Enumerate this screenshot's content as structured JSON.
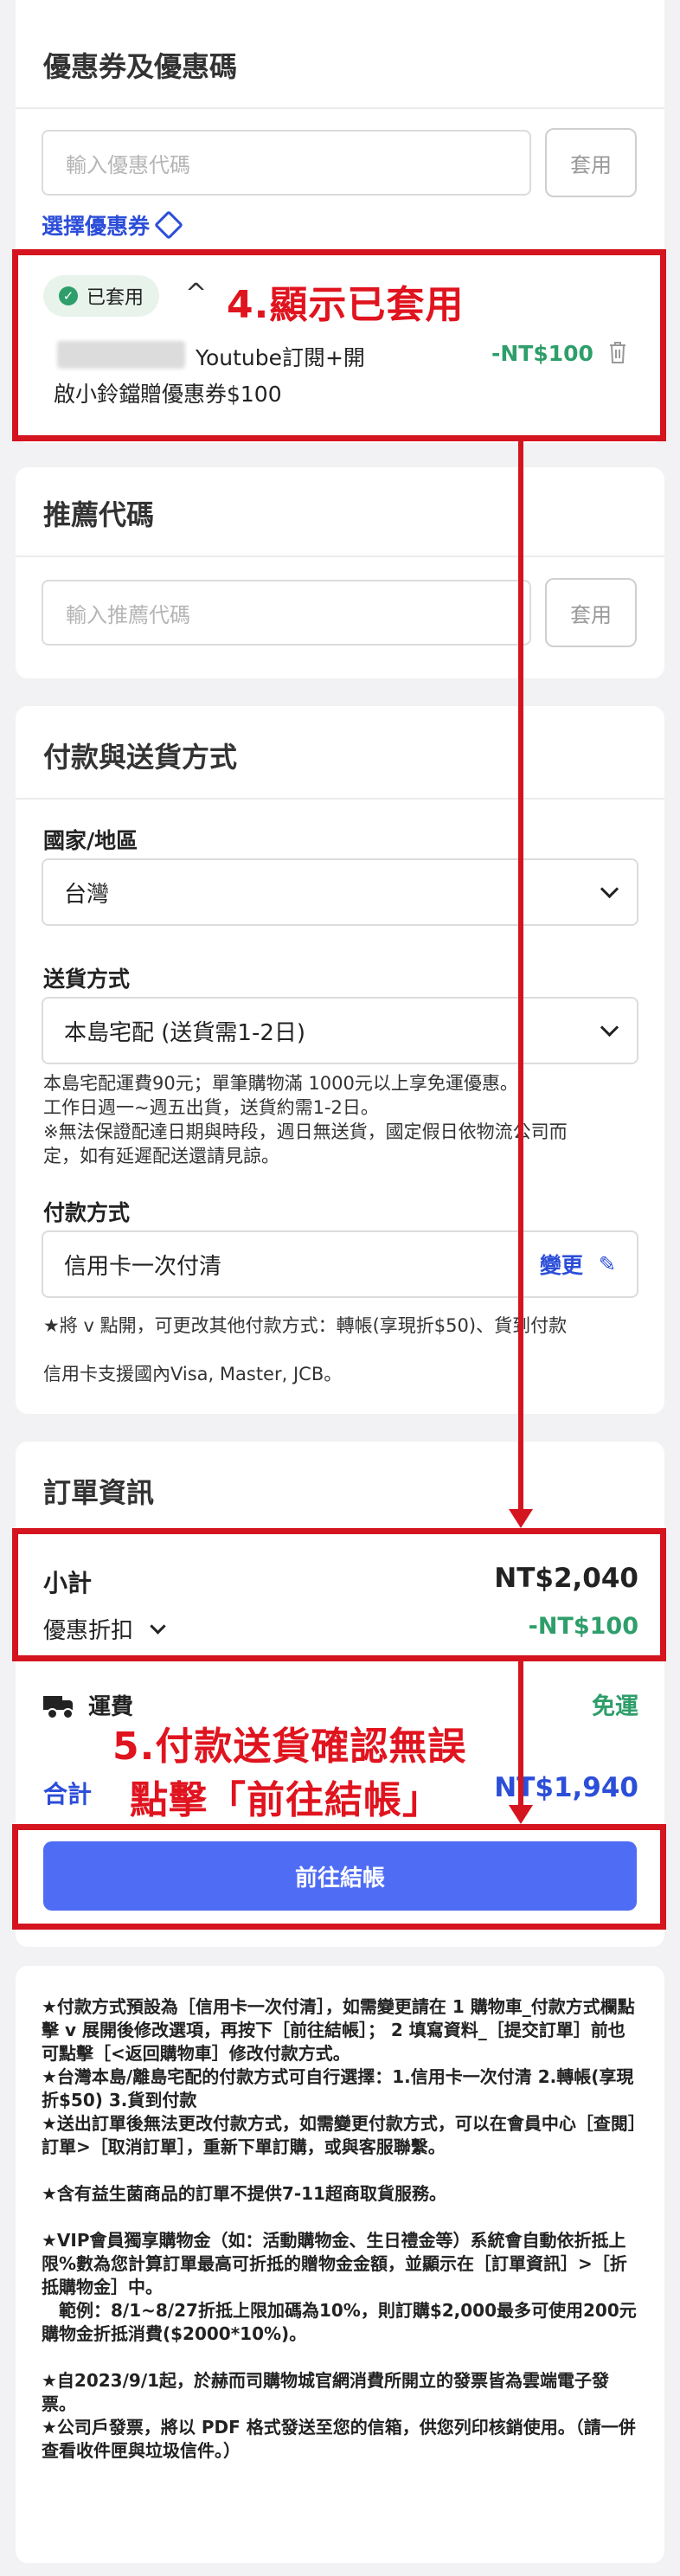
{
  "coupon": {
    "title": "優惠券及優惠碼",
    "input_placeholder": "輸入優惠代碼",
    "apply_label": "套用",
    "choose_label": "選擇優惠券",
    "applied_badge": "已套用",
    "item_line1": "Youtube訂閱+開",
    "item_line2": "啟小鈴鐺贈優惠券$100",
    "item_amount": "-NT$100"
  },
  "referral": {
    "title": "推薦代碼",
    "input_placeholder": "輸入推薦代碼",
    "apply_label": "套用"
  },
  "payment": {
    "title": "付款與送貨方式",
    "country_label": "國家/地區",
    "country_value": "台灣",
    "shipping_label": "送貨方式",
    "shipping_value": "本島宅配 (送貨需1-2日)",
    "shipping_note": [
      "本島宅配運費90元；單筆購物滿 1000元以上享免運優惠。",
      "工作日週一~週五出貨，送貨約需1-2日。",
      "※無法保證配達日期與時段，週日無送貨，國定假日依物流公司而",
      "定，如有延遲配送還請見諒。"
    ],
    "method_label": "付款方式",
    "method_value": "信用卡一次付清",
    "change_label": "變更",
    "method_note": "★將 v 點開，可更改其他付款方式：轉帳(享現折$50)、貨到付款",
    "card_note": "信用卡支援國內Visa, Master, JCB。"
  },
  "order": {
    "title": "訂單資訊",
    "subtotal_label": "小計",
    "subtotal_value": "NT$2,040",
    "discount_label": "優惠折扣",
    "discount_value": "-NT$100",
    "shipping_label": "運費",
    "shipping_value": "免運",
    "total_label": "合計",
    "total_value": "NT$1,940",
    "checkout_label": "前往結帳"
  },
  "annotations": {
    "step4": "4.顯示已套用",
    "step5_line1": "5.付款送貨確認無誤",
    "step5_line2": "點擊「前往結帳」"
  },
  "notes": [
    "★付款方式預設為［信用卡一次付清］，如需變更請在 1 購物車_付款方式欄點擊 v 展開後修改選項，再按下［前往結帳］； 2 填寫資料_［提交訂單］前也可點擊［<返回購物車］修改付款方式。",
    "★台灣本島/離島宅配的付款方式可自行選擇：1.信用卡一次付清 2.轉帳(享現折$50) 3.貨到付款",
    "★送出訂單後無法更改付款方式，如需變更付款方式，可以在會員中心［查閱］訂單>［取消訂單］，重新下單訂購，或與客服聯繫。",
    "",
    "★含有益生菌商品的訂單不提供7-11超商取貨服務。",
    "",
    "★VIP會員獨享購物金（如：活動購物金、生日禮金等）系統會自動依折抵上限%數為您計算訂單最高可折抵的贈物金金額，並顯示在［訂單資訊］>［折抵購物金］中。",
    "　範例：8/1~8/27折抵上限加碼為10%，則訂購$2,000最多可使用200元購物金折抵消費($2000*10%)。",
    "",
    "★自2023/9/1起，於赫而司購物城官網消費所開立的發票皆為雲端電子發票。",
    "★公司戶發票，將以 PDF 格式發送至您的信箱，供您列印核銷使用。（請一併查看收件匣與垃圾信件。）"
  ],
  "colors": {
    "accent_blue": "#2c4ed8",
    "checkout_button": "#4f6cf4",
    "green": "#2e9e6a",
    "annotation_red": "#d4141f"
  }
}
